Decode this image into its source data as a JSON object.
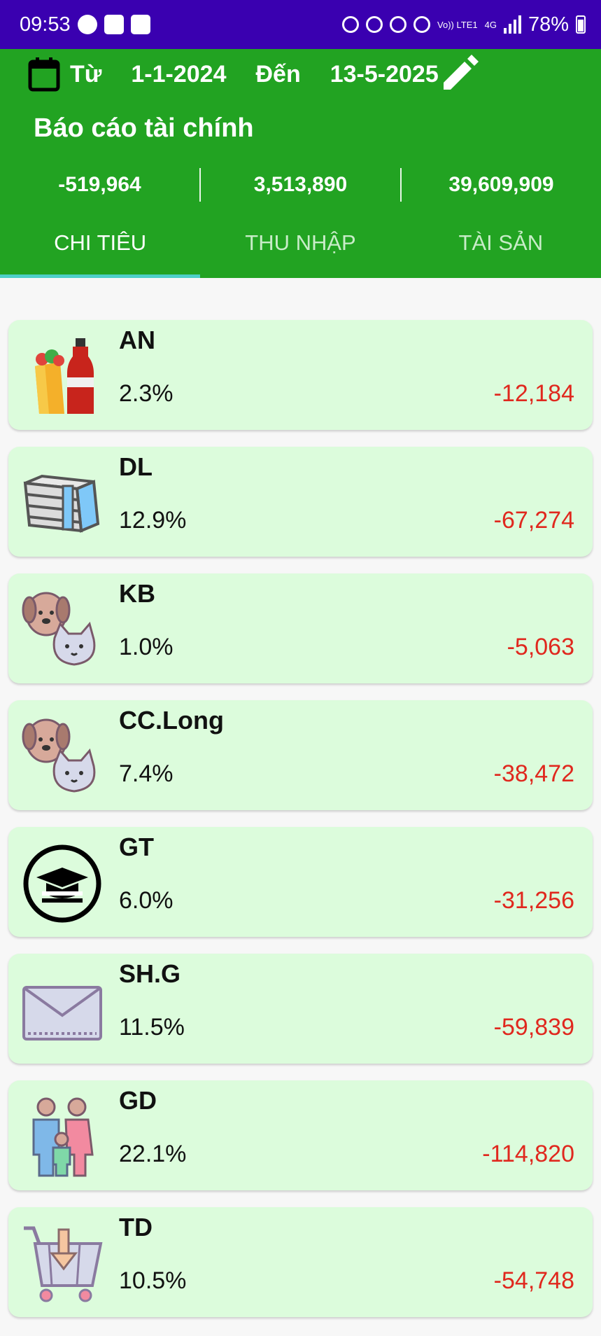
{
  "status_bar": {
    "time": "09:53",
    "battery": "78%",
    "network_volte": "Vo)) LTE1",
    "network_gen": "4G"
  },
  "header": {
    "from_label": "Từ",
    "from_date": "1-1-2024",
    "to_label": "Đến",
    "to_date": "13-5-2025",
    "title": "Báo cáo tài chính",
    "totals": [
      "-519,964",
      "3,513,890",
      "39,609,909"
    ]
  },
  "tabs": [
    {
      "label": "CHI TIÊU",
      "active": true
    },
    {
      "label": "THU NHẬP",
      "active": false
    },
    {
      "label": "TÀI SẢN",
      "active": false
    }
  ],
  "categories": [
    {
      "name": "AN",
      "percent": "2.3%",
      "amount": "-12,184",
      "icon": "food-drink-icon"
    },
    {
      "name": "DL",
      "percent": "12.9%",
      "amount": "-67,274",
      "icon": "money-stack-icon"
    },
    {
      "name": "KB",
      "percent": "1.0%",
      "amount": "-5,063",
      "icon": "pets-icon"
    },
    {
      "name": "CC.Long",
      "percent": "7.4%",
      "amount": "-38,472",
      "icon": "pets-icon"
    },
    {
      "name": "GT",
      "percent": "6.0%",
      "amount": "-31,256",
      "icon": "graduation-cap-icon"
    },
    {
      "name": "SH.G",
      "percent": "11.5%",
      "amount": "-59,839",
      "icon": "envelope-icon"
    },
    {
      "name": "GD",
      "percent": "22.1%",
      "amount": "-114,820",
      "icon": "family-icon"
    },
    {
      "name": "TD",
      "percent": "10.5%",
      "amount": "-54,748",
      "icon": "shopping-basket-icon"
    }
  ],
  "colors": {
    "status_bar": "#3a00b0",
    "header": "#22a322",
    "card": "#dcfcdc",
    "amount": "#e0281e",
    "tab_indicator": "#4dd0c8"
  }
}
